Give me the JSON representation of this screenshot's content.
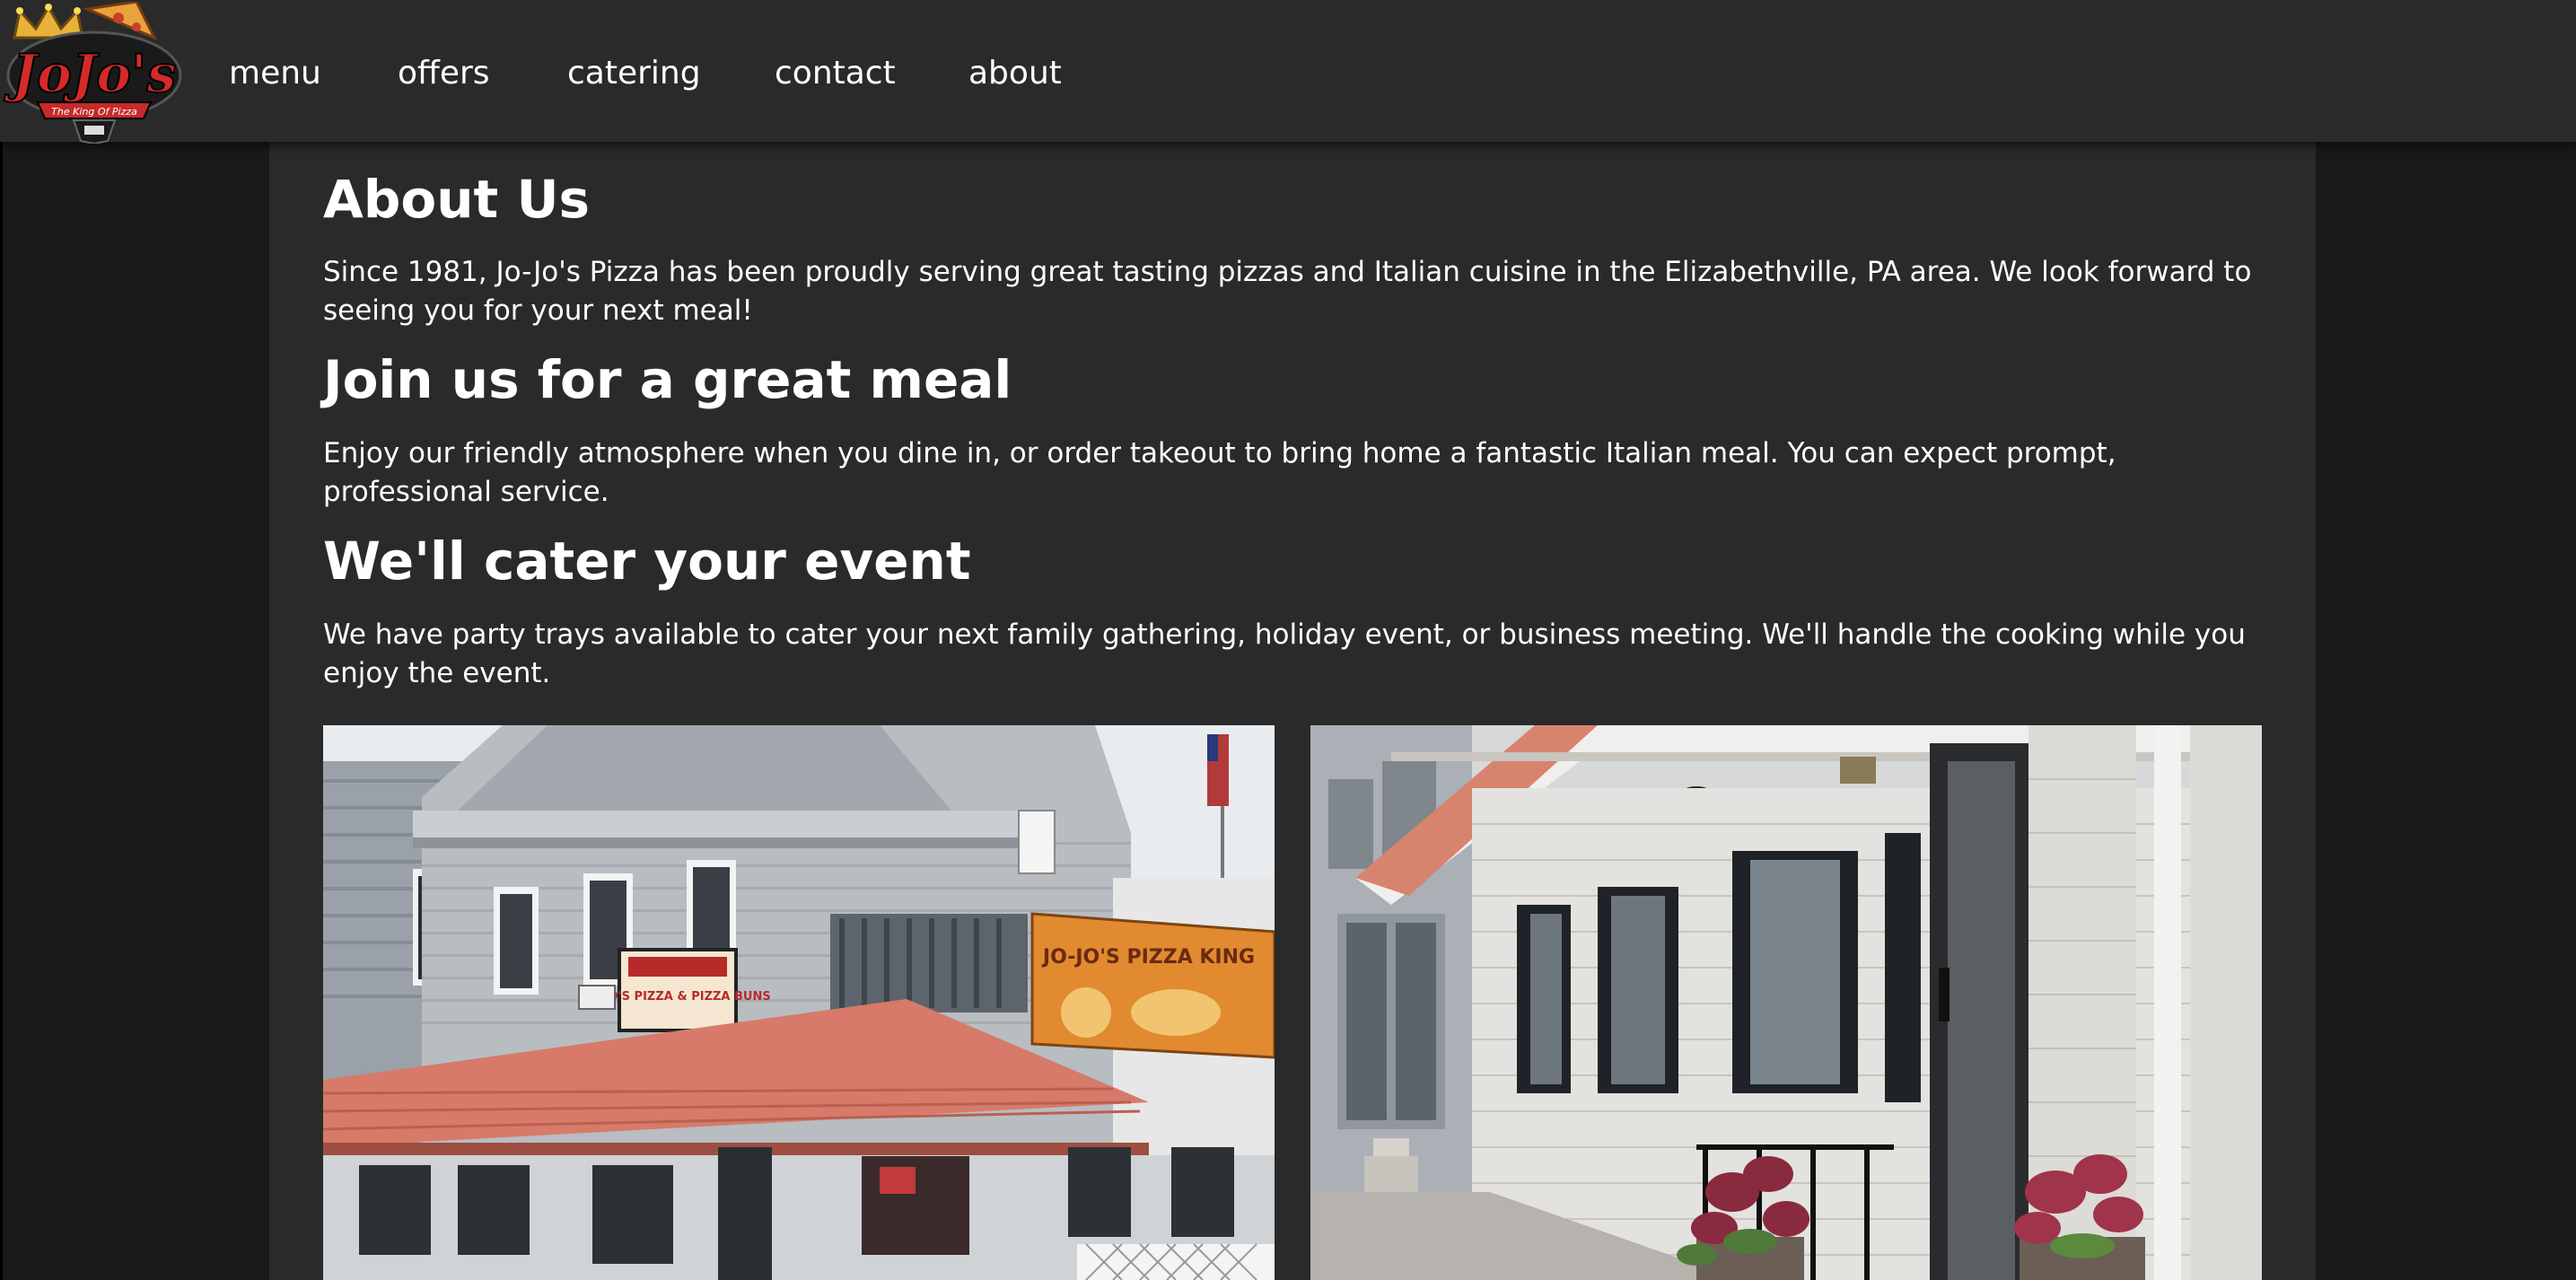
{
  "brand": {
    "logo_text": "JoJo's",
    "logo_tagline": "The King Of Pizza"
  },
  "nav": {
    "items": [
      {
        "label": "menu"
      },
      {
        "label": "offers"
      },
      {
        "label": "catering"
      },
      {
        "label": "contact"
      },
      {
        "label": "about"
      }
    ]
  },
  "about": {
    "title": "About Us",
    "text": "Since 1981, Jo-Jo's Pizza has been proudly serving great tasting pizzas and Italian cuisine in the Elizabethville, PA area. We look forward to seeing you for your next meal!"
  },
  "meal": {
    "title": "Join us for a great meal",
    "text": "Enjoy our friendly atmosphere when you dine in, or order takeout to bring home a fantastic Italian meal. You can expect prompt, professional service."
  },
  "cater": {
    "title": "We'll cater your event",
    "text": "We have party trays available to cater your next family gathering, holiday event, or business meeting. We'll handle the cooking while you enjoy the event."
  },
  "photos": {
    "exterior_sign_text": "JO-JO'S PIZZA & PIZZA BUNS",
    "marquee_text": "JO-JO'S PIZZA KING"
  },
  "colors": {
    "navbar": "#2a2a2a",
    "content_bg": "#2a2a2a",
    "page_bg": "#191919",
    "text": "#ffffff",
    "roof": "#d77a6a",
    "logo_red": "#d42a2a",
    "crown_gold": "#e8b23a"
  }
}
